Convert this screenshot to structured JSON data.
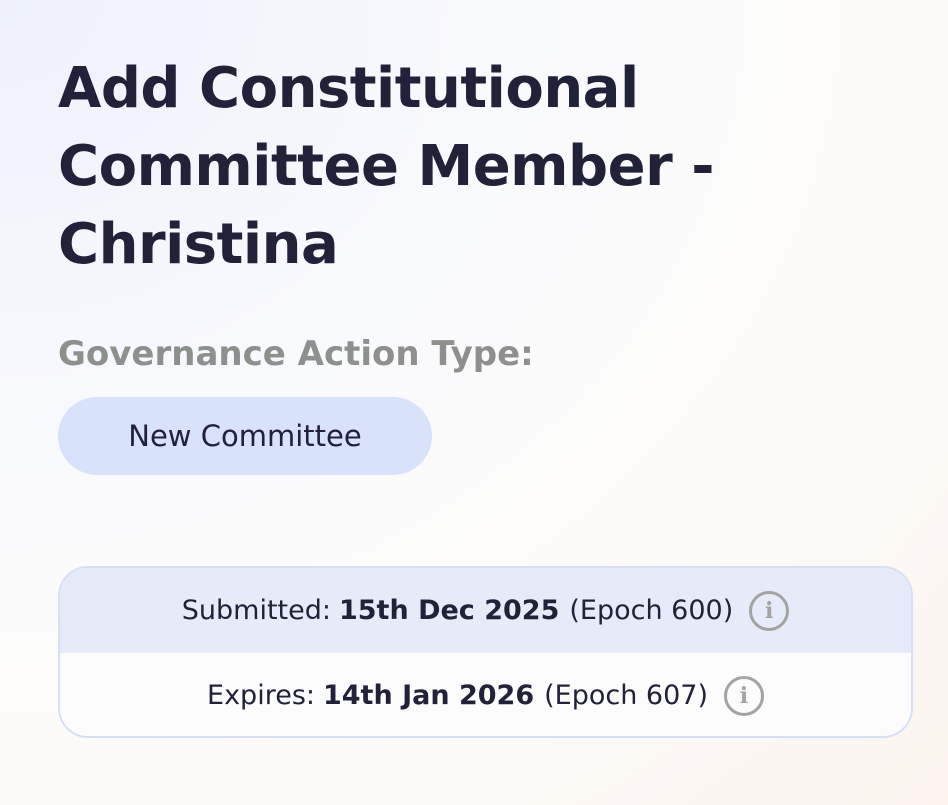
{
  "header": {
    "title": "Add Constitutional Committee Member - Christina"
  },
  "governance_action": {
    "type_label": "Governance Action Type:",
    "type_value": "New Committee"
  },
  "dates": {
    "submitted": {
      "label": "Submitted:",
      "date": "15th Dec 2025",
      "epoch": "(Epoch 600)",
      "icon": "info-icon"
    },
    "expires": {
      "label": "Expires:",
      "date": "14th Jan 2026",
      "epoch": "(Epoch 607)",
      "icon": "info-icon"
    }
  },
  "colors": {
    "heading": "#212239",
    "muted_label": "#8e908e",
    "chip_bg": "#d8e2fb",
    "submitted_row_bg": "#e7ebf9",
    "border": "#d6e0f4",
    "icon": "#a3a3a3"
  }
}
